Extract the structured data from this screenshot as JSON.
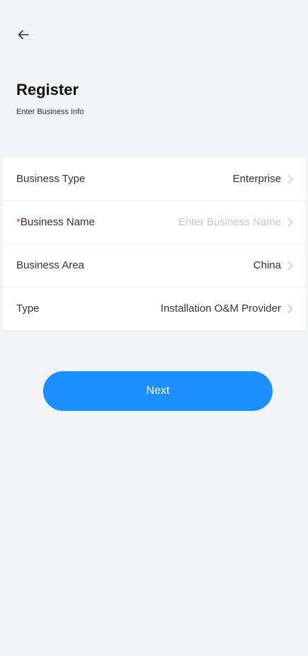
{
  "header": {
    "back_icon": "arrow-left-icon",
    "title": "Register",
    "subtitle": "Enter Business Info"
  },
  "form": {
    "rows": [
      {
        "label": "Business Type",
        "value": "Enterprise",
        "required": false
      },
      {
        "label": "Business Name",
        "placeholder": "Enter Business Name",
        "required": true,
        "required_mark": "*"
      },
      {
        "label": "Business Area",
        "value": "China",
        "required": false
      },
      {
        "label": "Type",
        "value": "Installation O&M Provider",
        "required": false
      }
    ],
    "chevron_icon": "chevron-right-icon"
  },
  "actions": {
    "next_label": "Next"
  },
  "colors": {
    "background": "#f2f3f5",
    "primary": "#1a90ff",
    "required": "#e5484d",
    "placeholder": "#c4c6cc"
  }
}
